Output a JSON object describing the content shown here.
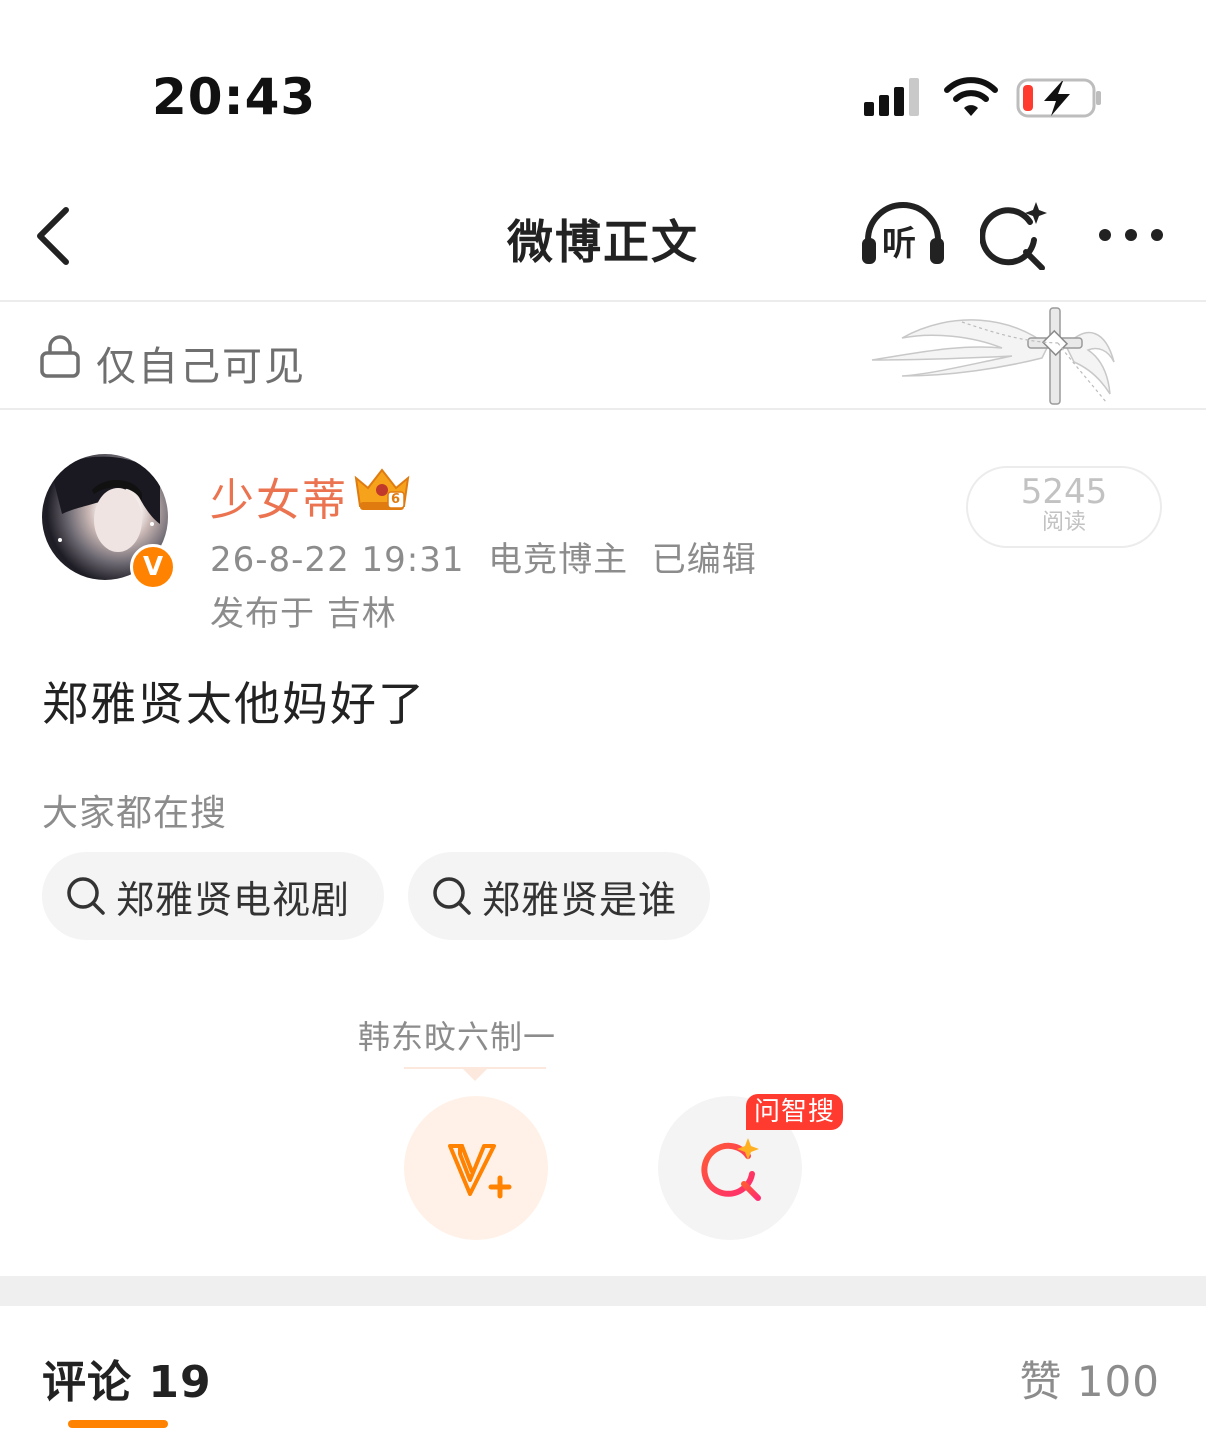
{
  "status_bar": {
    "time": "20:43",
    "icons": [
      "cellular-signal-icon",
      "wifi-icon",
      "battery-charging-icon"
    ]
  },
  "nav": {
    "title": "微博正文",
    "listen_label": "听",
    "icons": [
      "back-arrow-icon",
      "listen-headphones-icon",
      "ai-search-icon",
      "more-icon"
    ]
  },
  "visibility": {
    "label": "仅自己可见",
    "icon": "lock-icon"
  },
  "post": {
    "author": {
      "name": "少女蒂",
      "badge_level": "6",
      "verified_mark": "V"
    },
    "date": "26-8-22 19:31",
    "role": "电竞博主",
    "edited": "已编辑",
    "location_prefix": "发布于",
    "location": "吉林",
    "reads": {
      "count": "5245",
      "label": "阅读"
    },
    "text": "郑雅贤太他妈好了"
  },
  "everyone_searching": {
    "heading": "大家都在搜",
    "chips": [
      {
        "label": "郑雅贤电视剧"
      },
      {
        "label": "郑雅贤是谁"
      }
    ]
  },
  "actions": {
    "tip": "韩东旼六制一",
    "ai_badge": "问智搜",
    "colors": {
      "accent": "#ff8200",
      "ai_badge": "#ff3b30"
    }
  },
  "tabs": {
    "comments_label": "评论",
    "comments_count": "19",
    "likes_label": "赞",
    "likes_count": "100"
  },
  "colors": {
    "author_name": "#eb7350",
    "muted_text": "#8c8c8c",
    "brand_orange": "#ff8200"
  }
}
